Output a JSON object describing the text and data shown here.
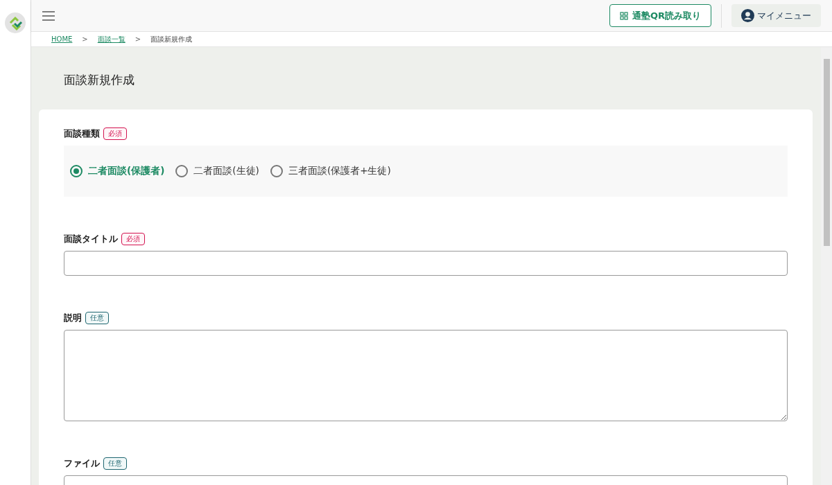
{
  "header": {
    "qr_button": "通塾QR読み取り",
    "my_menu": "マイメニュー"
  },
  "breadcrumb": [
    {
      "label": "HOME",
      "kind": "link"
    },
    {
      "label": ">",
      "kind": "sep"
    },
    {
      "label": "面談一覧",
      "kind": "link"
    },
    {
      "label": ">",
      "kind": "sep"
    },
    {
      "label": "面談新規作成",
      "kind": "current"
    }
  ],
  "page_title": "面談新規作成",
  "fields": [
    {
      "kind": "radio",
      "label": "面談種類",
      "badge": {
        "kind": "required",
        "text": "必須"
      },
      "options": [
        {
          "label": "二者面談(保護者)",
          "selected": true
        },
        {
          "label": "二者面談(生徒)",
          "selected": false
        },
        {
          "label": "三者面談(保護者+生徒)",
          "selected": false
        }
      ]
    },
    {
      "kind": "text",
      "label": "面談タイトル",
      "badge": {
        "kind": "required",
        "text": "必須"
      }
    },
    {
      "kind": "textarea",
      "label": "説明",
      "badge": {
        "kind": "optional",
        "text": "任意"
      }
    },
    {
      "kind": "file",
      "label": "ファイル",
      "badge": {
        "kind": "optional",
        "text": "任意"
      }
    }
  ]
}
